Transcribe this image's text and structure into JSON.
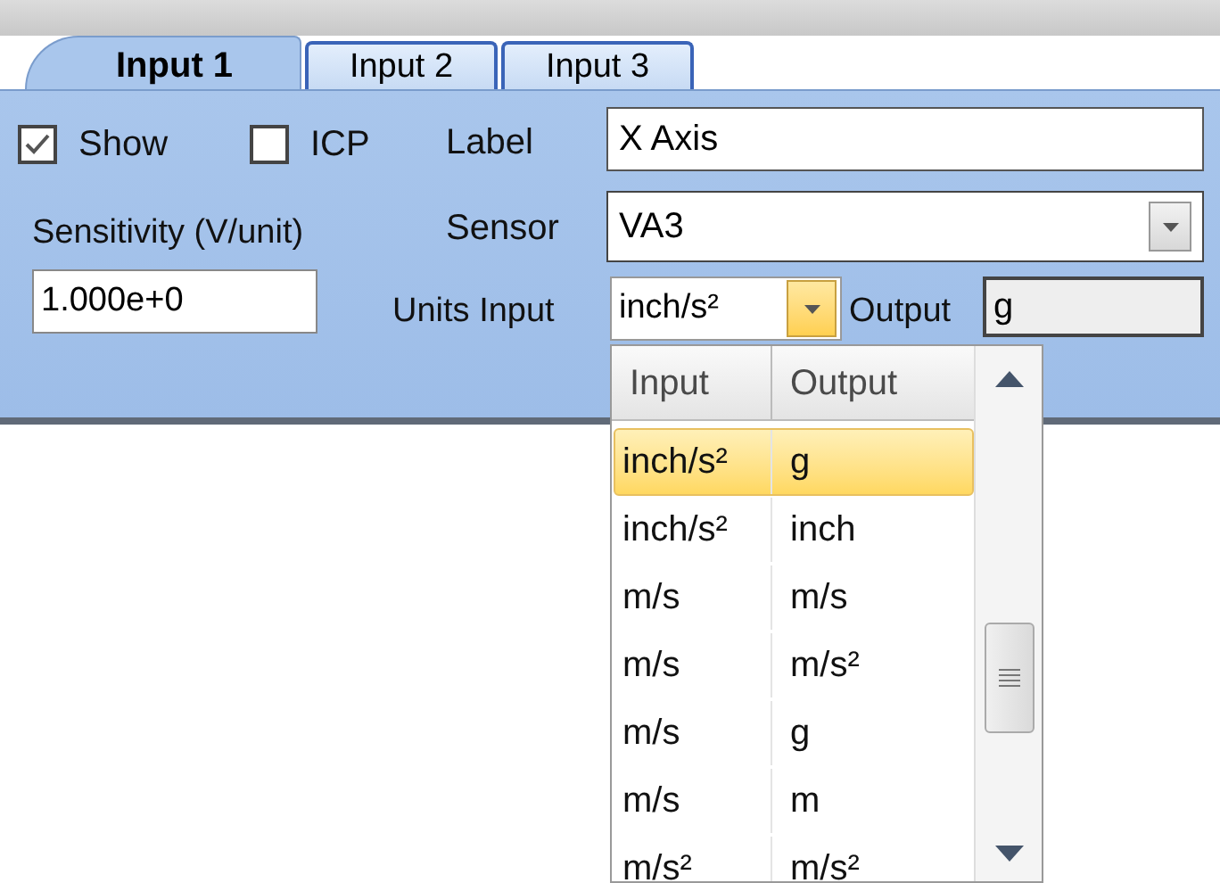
{
  "tabs": [
    {
      "label": "Input 1",
      "selected": true
    },
    {
      "label": "Input 2",
      "selected": false
    },
    {
      "label": "Input 3",
      "selected": false
    }
  ],
  "show": {
    "label": "Show",
    "checked": true
  },
  "icp": {
    "label": "ICP",
    "checked": false
  },
  "label_field": {
    "label": "Label",
    "value": "X Axis"
  },
  "sensitivity": {
    "label": "Sensitivity (V/unit)",
    "value": "1.000e+0"
  },
  "sensor": {
    "label": "Sensor",
    "value": "VA3"
  },
  "units_input": {
    "label": "Units Input",
    "value": "inch/s²",
    "expanded": true
  },
  "output": {
    "label": "Output",
    "value": "g"
  },
  "units_list": {
    "columns": [
      "Input",
      "Output"
    ],
    "rows": [
      {
        "input": "inch/s²",
        "output": "g",
        "selected": true
      },
      {
        "input": "inch/s²",
        "output": "inch",
        "selected": false
      },
      {
        "input": "m/s",
        "output": "m/s",
        "selected": false
      },
      {
        "input": "m/s",
        "output": "m/s²",
        "selected": false
      },
      {
        "input": "m/s",
        "output": "g",
        "selected": false
      },
      {
        "input": "m/s",
        "output": "m",
        "selected": false
      },
      {
        "input": "m/s²",
        "output": "m/s²",
        "selected": false
      }
    ]
  }
}
